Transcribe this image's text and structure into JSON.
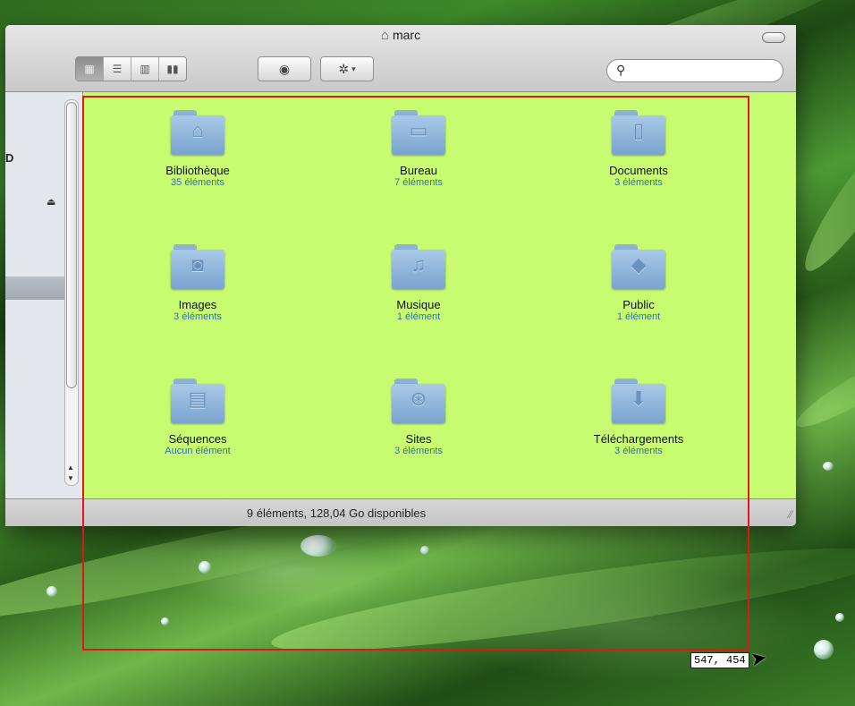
{
  "window": {
    "title": "marc",
    "search_placeholder": "",
    "status": "9 éléments, 128,04 Go disponibles"
  },
  "toolbar": {
    "view_modes": [
      "icon-view",
      "list-view",
      "column-view",
      "coverflow-view"
    ],
    "active_view": "icon-view"
  },
  "sidebar": {
    "partial_label": "D"
  },
  "items": [
    {
      "name": "Bibliothèque",
      "count": "35 éléments",
      "icon": "library-folder-icon"
    },
    {
      "name": "Bureau",
      "count": "7 éléments",
      "icon": "desktop-folder-icon"
    },
    {
      "name": "Documents",
      "count": "3 éléments",
      "icon": "documents-folder-icon"
    },
    {
      "name": "Images",
      "count": "3 éléments",
      "icon": "pictures-folder-icon"
    },
    {
      "name": "Musique",
      "count": "1 élément",
      "icon": "music-folder-icon"
    },
    {
      "name": "Public",
      "count": "1 élément",
      "icon": "public-folder-icon"
    },
    {
      "name": "Séquences",
      "count": "Aucun élément",
      "icon": "movies-folder-icon"
    },
    {
      "name": "Sites",
      "count": "3 éléments",
      "icon": "sites-folder-icon"
    },
    {
      "name": "Téléchargements",
      "count": "3 éléments",
      "icon": "downloads-folder-icon"
    }
  ],
  "selection": {
    "readout": "547, 454",
    "color": "#e1161b"
  },
  "colors": {
    "content_background": "#c8fc70",
    "count_text": "#2f6fb0"
  }
}
